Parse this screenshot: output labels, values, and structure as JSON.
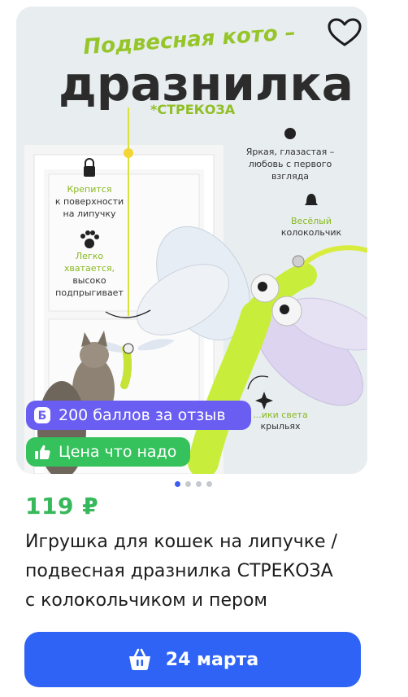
{
  "product_image": {
    "headline_line1": "Подвесная кото –",
    "headline_line2": "дразнилка",
    "variant_tag": "*СТРЕКОЗА",
    "feature_1": [
      "Крепится",
      "к поверхности",
      "на липучку"
    ],
    "feature_2": [
      "Легко",
      "хватается,",
      "высоко",
      "подпрыгивает"
    ],
    "feature_3": [
      "Яркая, глазастая –",
      "любовь с первого",
      "взгляда"
    ],
    "feature_4": [
      "Весёлый",
      "колокольчик"
    ],
    "feature_5": [
      "...ики света",
      "крыльях"
    ]
  },
  "badges": {
    "bonus": "200 баллов за отзыв",
    "deal": "Цена что надо"
  },
  "carousel": {
    "count": 4,
    "active": 0
  },
  "price": "119 ₽",
  "title_lines": [
    "Игрушка для кошек на липучке /",
    "подвесная дразнилка СТРЕКОЗА",
    "с колокольчиком и пером"
  ],
  "delivery_label": "24 марта",
  "colors": {
    "accent_blue": "#2e63f5",
    "price_green": "#36b85b",
    "bonus_purple": "#6a5df1",
    "deal_green": "#35c15c"
  }
}
